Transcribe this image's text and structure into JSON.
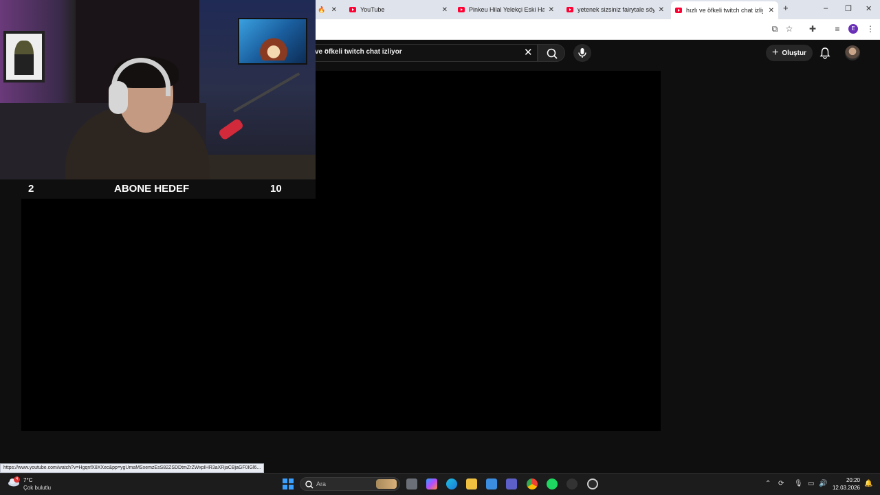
{
  "browser": {
    "tabs": [
      {
        "title": "YouTube"
      },
      {
        "title": "Pinkeu Hilal Yelekçi Eski Hali - Y"
      },
      {
        "title": "yetenek sizsiniz fairytale söyley"
      },
      {
        "title": "hızlı ve öfkeli twitch chat izliyo"
      }
    ],
    "new_tab": "+",
    "win_minimize": "–",
    "win_restore": "❐",
    "win_close": "✕",
    "profile_initial": "E"
  },
  "youtube": {
    "search_query": "ve öfkeli twitch chat izliyor",
    "clear_glyph": "✕",
    "create_label": "Oluştur",
    "create_plus": "+"
  },
  "overlay": {
    "goal_current": "2",
    "goal_label": "ABONE HEDEF",
    "goal_target": "10"
  },
  "status_url": "https://www.youtube.com/watch?v=HgqnfX8XXec&pp=ygUmaMSxemzEsS82ZSDDtmZrZWxpIHR3aXRjaCBjaGF0IGl6...",
  "taskbar": {
    "weather_badge": "4",
    "temperature": "7°C",
    "condition": "Çok bulutlu",
    "search_placeholder": "Ara",
    "time": "20:20",
    "date": "12.03.2026"
  }
}
